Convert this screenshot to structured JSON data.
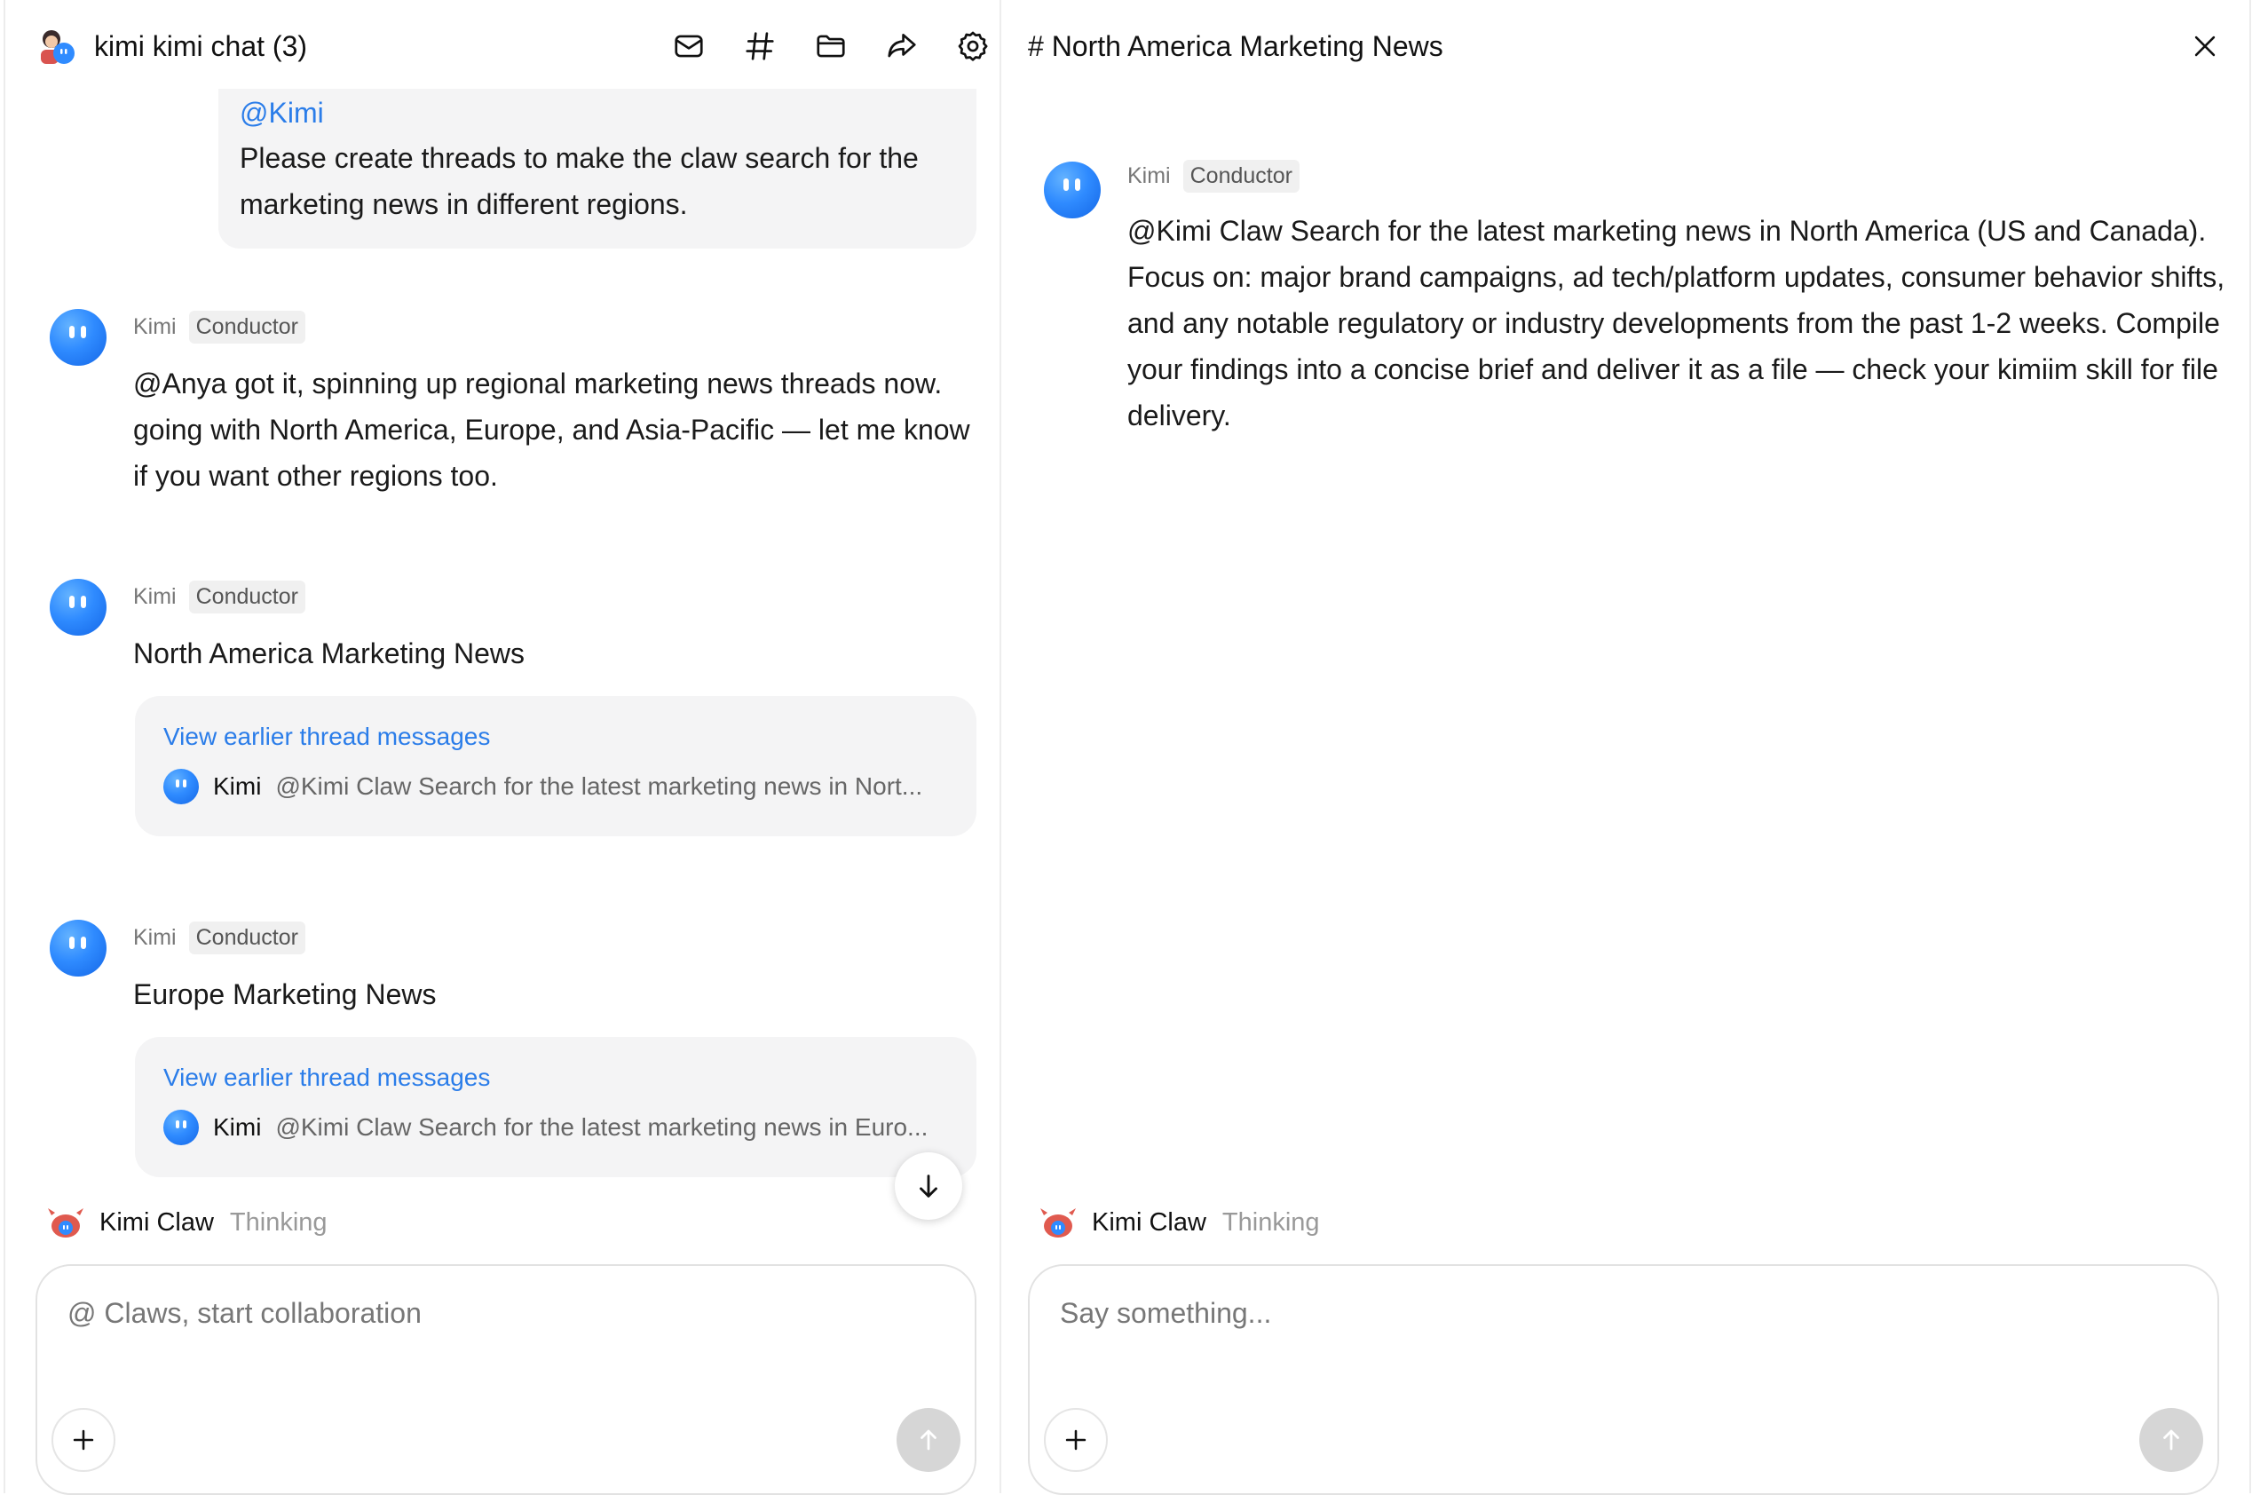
{
  "left": {
    "title": "kimi kimi chat (3)",
    "toolbar": [
      {
        "icon": "mail-icon"
      },
      {
        "icon": "hash-icon"
      },
      {
        "icon": "folder-icon"
      },
      {
        "icon": "share-icon"
      },
      {
        "icon": "gear-icon"
      }
    ],
    "user_message": {
      "mention": "@Kimi",
      "text": "Please create  threads to make the claw search for the marketing news in different regions."
    },
    "messages": [
      {
        "sender": "Kimi",
        "role": "Conductor",
        "text": "@Anya got it, spinning up regional marketing news threads now. going with North America, Europe, and Asia-Pacific — let me know if you want other regions too."
      },
      {
        "sender": "Kimi",
        "role": "Conductor",
        "text": "North America Marketing News",
        "thread": {
          "link": "View earlier thread messages",
          "preview_sender": "Kimi",
          "preview_text": "@Kimi Claw Search for the latest marketing news in Nort..."
        }
      },
      {
        "sender": "Kimi",
        "role": "Conductor",
        "text": "Europe Marketing News",
        "thread": {
          "link": "View earlier thread messages",
          "preview_sender": "Kimi",
          "preview_text": "@Kimi Claw Search for the latest marketing news in Euro..."
        }
      }
    ],
    "status": {
      "name": "Kimi Claw",
      "state": "Thinking"
    },
    "composer": {
      "placeholder": "@ Claws, start collaboration"
    }
  },
  "right": {
    "title": "# North America Marketing News",
    "message": {
      "sender": "Kimi",
      "role": "Conductor",
      "text": "@Kimi Claw Search for the latest marketing news in North America (US and Canada). Focus on: major brand campaigns, ad tech/platform updates, consumer behavior shifts, and any notable regulatory or industry developments from the past 1-2 weeks. Compile your findings into a concise brief and deliver it as a file — check your kimiim skill for file delivery."
    },
    "status": {
      "name": "Kimi Claw",
      "state": "Thinking"
    },
    "composer": {
      "placeholder": "Say something..."
    }
  },
  "colors": {
    "accent": "#2b7de9",
    "bubble": "#f4f4f5",
    "kimi_avatar": "#2f8bff",
    "muted": "#999999"
  }
}
